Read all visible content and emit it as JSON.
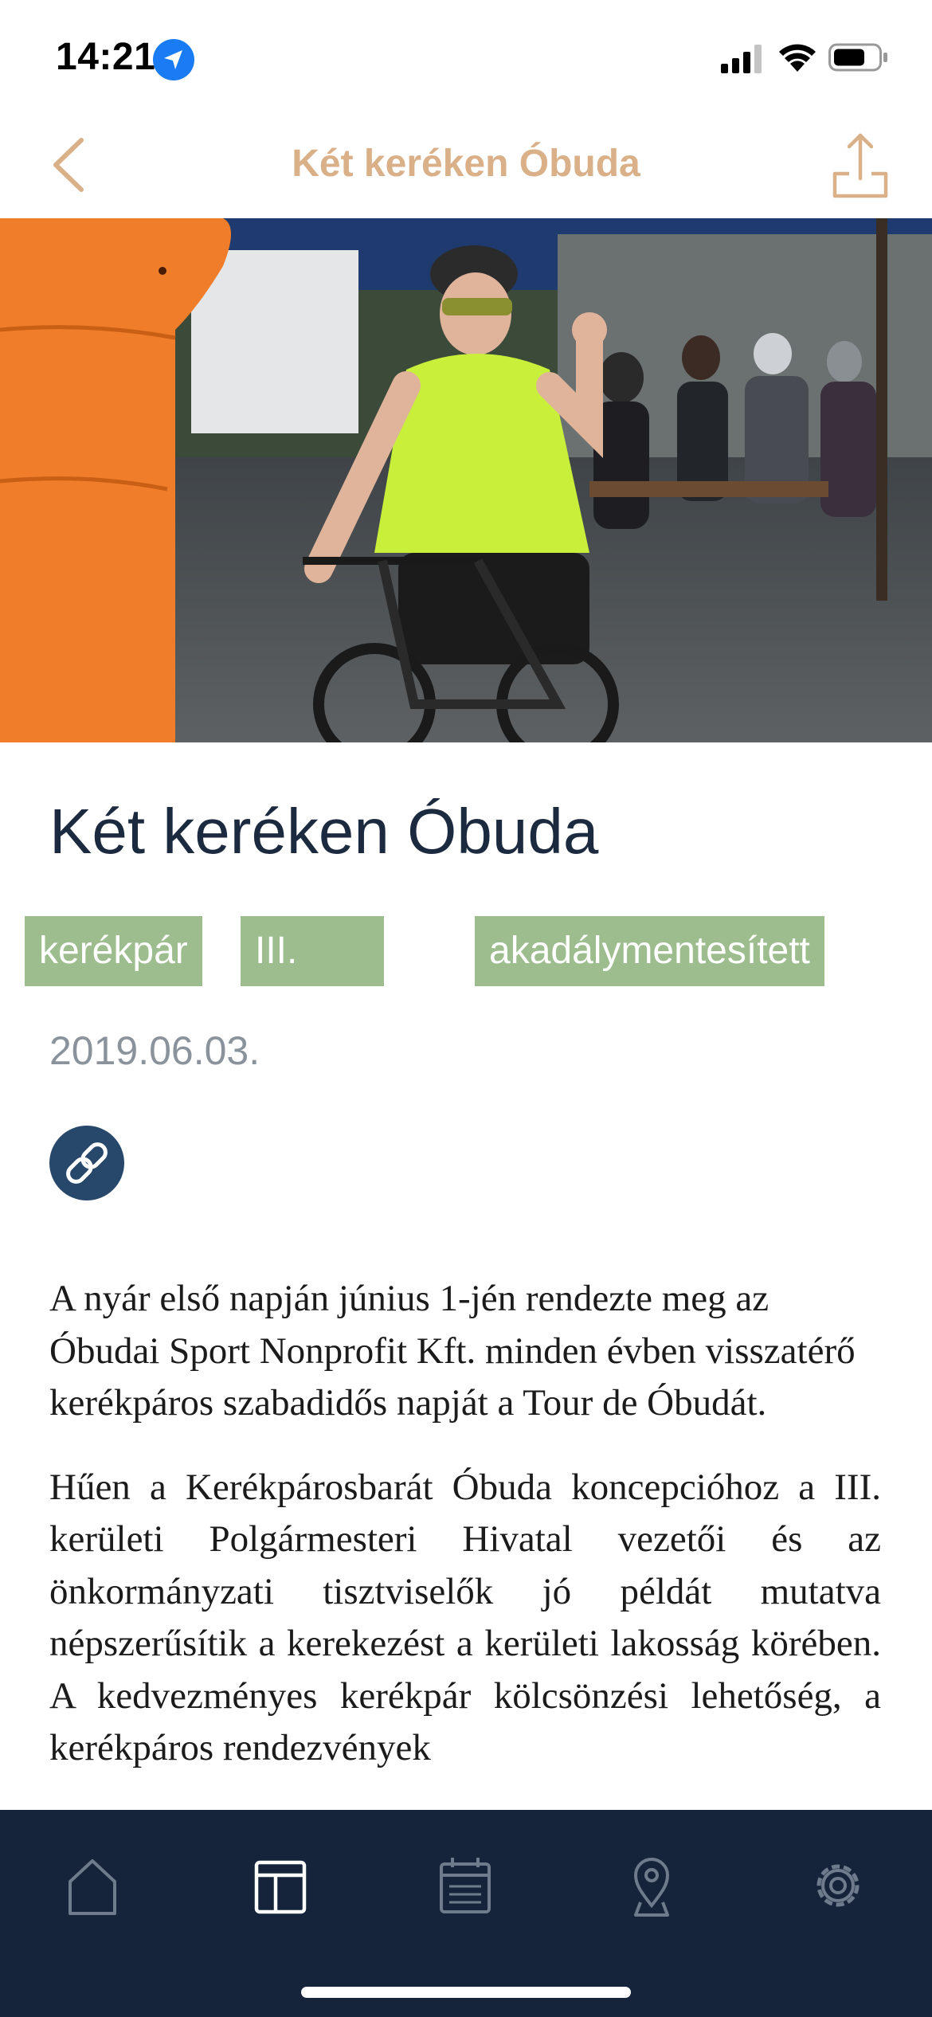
{
  "status_bar": {
    "time": "14:21",
    "icons": [
      "location-arrow-icon",
      "cellular-signal-icon",
      "wifi-icon",
      "battery-icon"
    ]
  },
  "nav": {
    "title": "Két keréken Óbuda",
    "back_icon": "chevron-left-icon",
    "share_icon": "share-icon"
  },
  "article": {
    "title": "Két keréken Óbuda",
    "tags": [
      "kerékpár",
      "III. kerület",
      "akadálymentesített"
    ],
    "date": "2019.06.03.",
    "link_icon": "link-icon",
    "paragraphs": [
      "A nyár első napján június 1-jén rendezte meg az Óbudai Sport Nonprofit Kft. minden évben visszatérő kerékpáros szabadidős napját a Tour de Óbudát.",
      "Hűen a Kerékpárosbarát Óbuda koncepcióhoz a III. kerületi Polgármesteri Hivatal vezetői és az önkormányzati tisztviselők jó példát mutatva népszerűsítik a kerekezést a kerületi lakosság körében. A kedvezményes kerékpár kölcsönzési lehetőség, a kerékpáros rendezvények"
    ]
  },
  "tab_bar": {
    "tabs": [
      "home-icon",
      "layout-icon",
      "calendar-icon",
      "map-pin-icon",
      "settings-icon"
    ],
    "active_index": 1
  },
  "colors": {
    "accent": "#d9b088",
    "tag_bg": "#9dbd8f",
    "tab_bar_bg": "#15243a",
    "title_color": "#1b2a3f",
    "link_button": "#27476b"
  }
}
